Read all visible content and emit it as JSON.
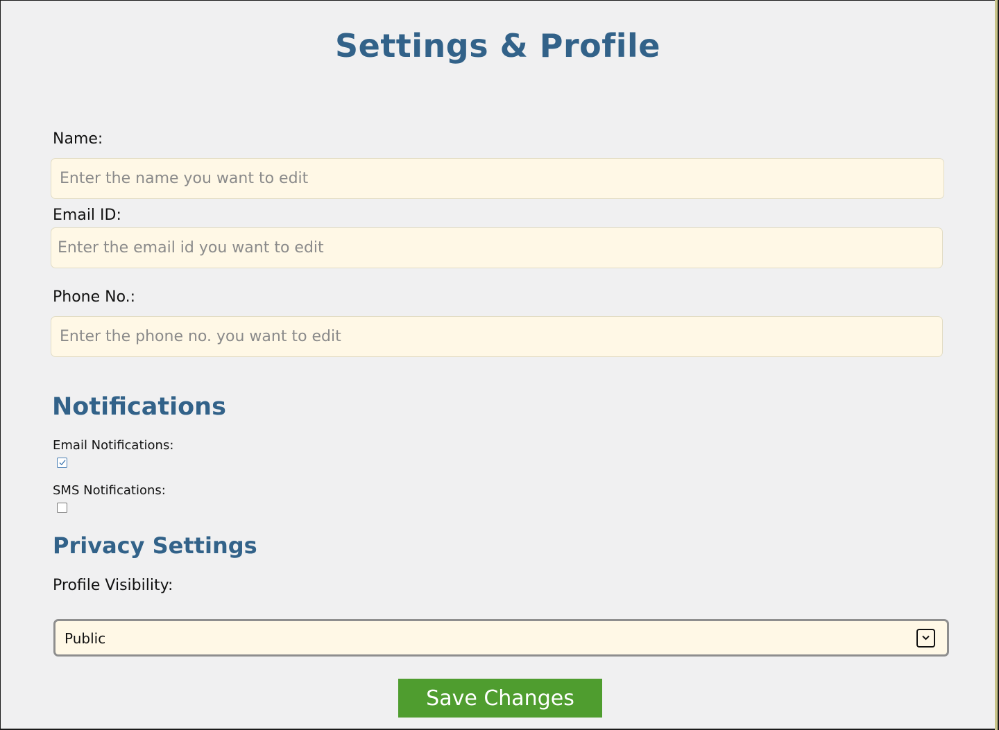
{
  "page": {
    "title": "Settings & Profile"
  },
  "profile": {
    "name": {
      "label": "Name:",
      "placeholder": "Enter the name you want to edit",
      "value": ""
    },
    "email": {
      "label": "Email ID:",
      "placeholder": "Enter the email id you want to edit",
      "value": ""
    },
    "phone": {
      "label": "Phone No.:",
      "placeholder": "Enter the phone no. you want to edit",
      "value": ""
    }
  },
  "notifications": {
    "heading": "Notifications",
    "email": {
      "label": "Email Notifications:",
      "checked": true
    },
    "sms": {
      "label": "SMS Notifications:",
      "checked": false
    }
  },
  "privacy": {
    "heading": "Privacy Settings",
    "visibility": {
      "label": "Profile Visibility:",
      "selected": "Public",
      "icon": "chevron-down-icon"
    }
  },
  "actions": {
    "save_label": "Save Changes"
  },
  "colors": {
    "heading": "#326289",
    "input_background": "#fff8e6",
    "page_background": "#f0f0f1",
    "save_button": "#4f9d2f"
  }
}
